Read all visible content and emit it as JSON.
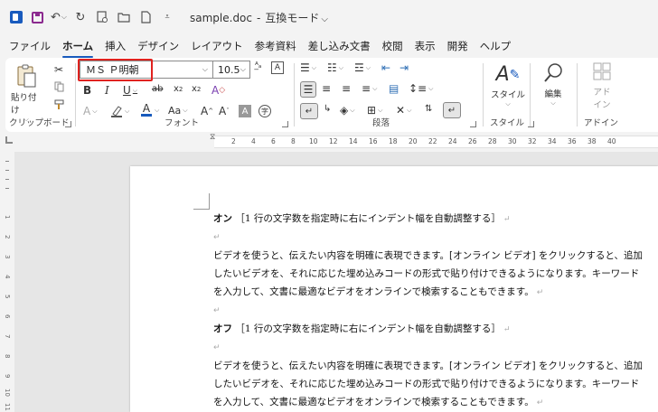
{
  "title_bar": {
    "document_name": "sample.doc",
    "separator": "-",
    "mode_label": "互換モード",
    "mode_chevron": "⌵"
  },
  "menu": {
    "tabs": [
      {
        "label": "ファイル"
      },
      {
        "label": "ホーム",
        "active": true
      },
      {
        "label": "挿入"
      },
      {
        "label": "デザイン"
      },
      {
        "label": "レイアウト"
      },
      {
        "label": "参考資料"
      },
      {
        "label": "差し込み文書"
      },
      {
        "label": "校閲"
      },
      {
        "label": "表示"
      },
      {
        "label": "開発"
      },
      {
        "label": "ヘルプ"
      }
    ]
  },
  "ribbon": {
    "clipboard": {
      "paste_label": "貼り付け",
      "group_label": "クリップボード"
    },
    "font": {
      "font_name": "ＭＳ Ｐ明朝",
      "font_size": "10.5",
      "group_label": "フォント"
    },
    "paragraph": {
      "group_label": "段落"
    },
    "style": {
      "style_label": "スタイル",
      "group_label": "スタイル"
    },
    "editing": {
      "label": "編集"
    },
    "addin": {
      "label_line1": "アド",
      "label_line2": "イン",
      "group_label": "アドイン"
    }
  },
  "ruler": {
    "numbers": [
      "2",
      "4",
      "6",
      "8",
      "10",
      "12",
      "14",
      "16",
      "18",
      "20",
      "22",
      "24",
      "26",
      "28",
      "30",
      "32",
      "34",
      "36",
      "38",
      "40"
    ]
  },
  "vertical_ruler": {
    "numbers": [
      "1",
      "2",
      "3",
      "4",
      "5",
      "6",
      "7",
      "8",
      "9",
      "10",
      "11"
    ]
  },
  "document": {
    "p1_heading_bold": "オン",
    "p1_heading_rest": "［1 行の文字数を指定時に右にインデント幅を自動調整する］",
    "body_line1": "ビデオを使うと、伝えたい内容を明確に表現できます。[オンライン ビデオ] をクリックすると、追加",
    "body_line2": "したいビデオを、それに応じた埋め込みコードの形式で貼り付けできるようになります。キーワード",
    "body_line3": "を入力して、文書に最適なビデオをオンラインで検索することもできます。",
    "p2_heading_bold": "オフ",
    "p2_heading_rest": "［1 行の文字数を指定時に右にインデント幅を自動調整する］",
    "paragraph_mark": "↵"
  },
  "colors": {
    "accent": "#185abd",
    "highlight_border": "#e0221f",
    "save_icon": "#8b2a8f"
  }
}
